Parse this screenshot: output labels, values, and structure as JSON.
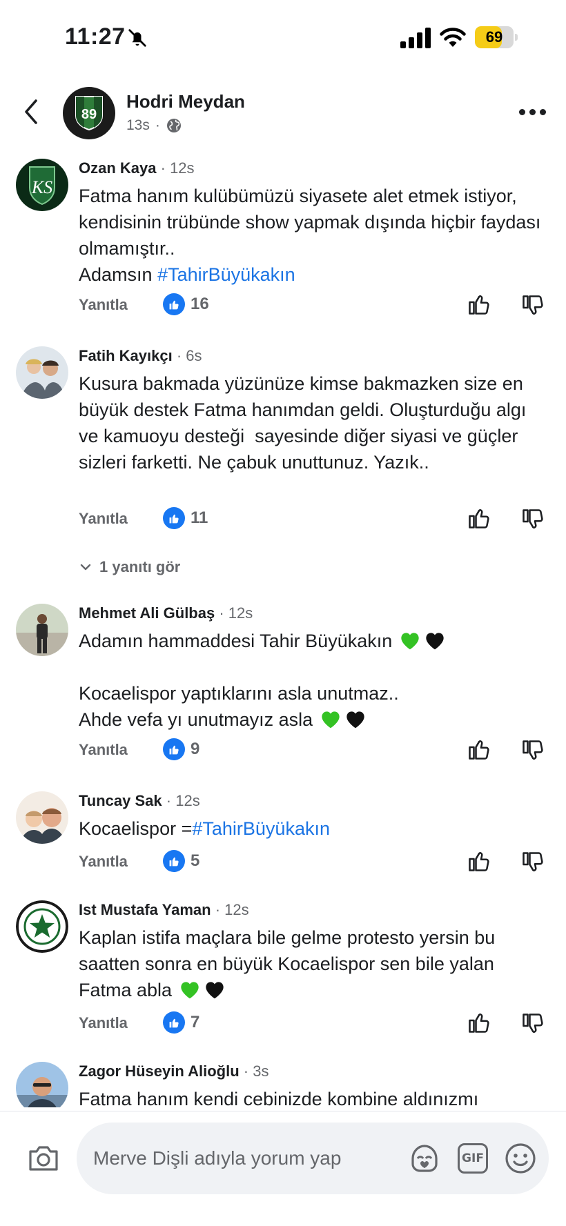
{
  "status_bar": {
    "time": "11:27",
    "battery": "69",
    "battery_level_percent": 69
  },
  "header": {
    "page_name": "Hodri Meydan",
    "page_avatar_text": "89",
    "post_time": "13s",
    "separator": "·"
  },
  "colors": {
    "link": "#1b74e4",
    "like_badge": "#1877f2",
    "secondary_text": "#65676b",
    "battery_yellow": "#f5cc17"
  },
  "labels": {
    "reply": "Yanıtla"
  },
  "comments": [
    {
      "author": "Ozan Kaya",
      "time": "· 12s",
      "text": "Fatma hanım kulübümüzü siyasete alet etmek istiyor, kendisinin trübünde show yapmak dışında hiçbir faydası olmamıştır..\nAdamsın ",
      "hashtag": "#TahirBüyükakın",
      "likes": "16"
    },
    {
      "author": "Fatih Kayıkçı",
      "time": "· 6s",
      "text": "Kusura bakmada yüzünüze kimse bakmazken size en büyük destek Fatma hanımdan geldi. Oluşturduğu algı ve kamuoyu desteği  sayesinde diğer siyasi ve güçler sizleri farketti. Ne çabuk unuttunuz. Yazık..",
      "likes": "11",
      "view_replies": "1 yanıtı gör"
    },
    {
      "author": "Mehmet Ali Gülbaş",
      "time": "· 12s",
      "line1": "Adamın hammaddesi Tahir Büyükakın",
      "line2": "Kocaelispor yaptıklarını asla unutmaz..",
      "line3": "Ahde vefa yı unutmayız asla",
      "likes": "9"
    },
    {
      "author": "Tuncay Sak",
      "time": "· 12s",
      "text": "Kocaelispor =",
      "hashtag": "#TahirBüyükakın",
      "likes": "5"
    },
    {
      "author": "Ist Mustafa Yaman",
      "time": "· 12s",
      "text": "Kaplan istifa maçlara bile gelme protesto yersin bu saatten sonra en büyük Kocaelispor sen bile yalan Fatma abla",
      "likes": "7"
    },
    {
      "author": "Zagor Hüseyin Alioğlu",
      "time": "· 3s",
      "text": "Fatma hanım kendi cebinizde kombine aldınızmı"
    }
  ],
  "composer": {
    "placeholder": "Merve Dişli adıyla yorum yap",
    "gif_label": "GIF"
  },
  "icons": [
    "bell-off-icon",
    "signal-icon",
    "wifi-icon",
    "back-icon",
    "globe-icon",
    "more-icon",
    "thumbs-up-icon",
    "thumbs-down-icon",
    "chevron-down-icon",
    "green-heart-icon",
    "black-heart-icon",
    "camera-icon",
    "avatar-sticker-icon",
    "gif-icon",
    "emoji-icon"
  ]
}
